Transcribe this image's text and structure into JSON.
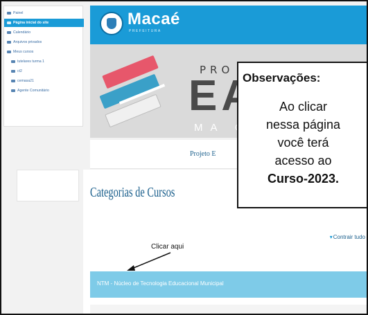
{
  "sidebar": {
    "items": [
      {
        "label": "Painel",
        "icon": "home-icon"
      },
      {
        "label": "Página inicial do site",
        "icon": "home-icon",
        "active": true
      },
      {
        "label": "Calendário",
        "icon": "calendar-icon"
      },
      {
        "label": "Arquivos privados",
        "icon": "file-icon"
      },
      {
        "label": "Meus cursos",
        "icon": "graduation-cap-icon"
      },
      {
        "label": "tutelares turma 1",
        "icon": "graduation-cap-icon"
      },
      {
        "label": "ct2",
        "icon": "graduation-cap-icon"
      },
      {
        "label": "cemasa21",
        "icon": "graduation-cap-icon"
      },
      {
        "label": "Agente Comunitário",
        "icon": "graduation-cap-icon"
      }
    ]
  },
  "header": {
    "logo_text": "Macaé",
    "logo_sub": "PREFEITURA"
  },
  "banner": {
    "line1": "PRO",
    "line2": "EA",
    "line3": "MA C"
  },
  "project_strip": {
    "text": "Projeto E"
  },
  "main": {
    "categories_title": "Categorias de Cursos",
    "collapse_all": "Contrair tudo",
    "click_here": "Clicar aqui",
    "category_item": "NTM - Núcleo de Tecnologia Educacional Municipal"
  },
  "callout": {
    "title": "Observações:",
    "line1": "Ao clicar",
    "line2": "nessa página",
    "line3": "você terá",
    "line4": "acesso ao",
    "line5_bold": "Curso-2023."
  },
  "colors": {
    "accent": "#1a9bd7",
    "link": "#1a5f8c",
    "category_bar": "#7ecbe8"
  }
}
